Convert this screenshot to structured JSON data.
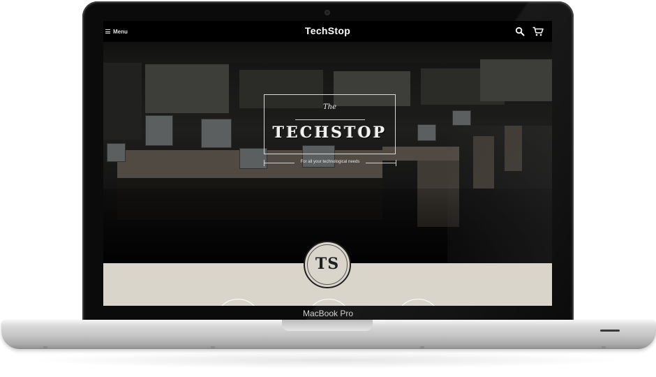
{
  "device": {
    "label": "MacBook Pro"
  },
  "navbar": {
    "menu_label": "Menu",
    "title": "TechStop",
    "icons": [
      "menu-icon",
      "search-icon",
      "cart-icon"
    ]
  },
  "hero": {
    "the": "The",
    "name": "TECHSTOP",
    "tagline": "For all your technological needs"
  },
  "badge": {
    "text": "TS"
  },
  "colors": {
    "beige": "#d9d5cb",
    "navbar": "#000000",
    "laptop_silver": "#c4c4c4"
  }
}
